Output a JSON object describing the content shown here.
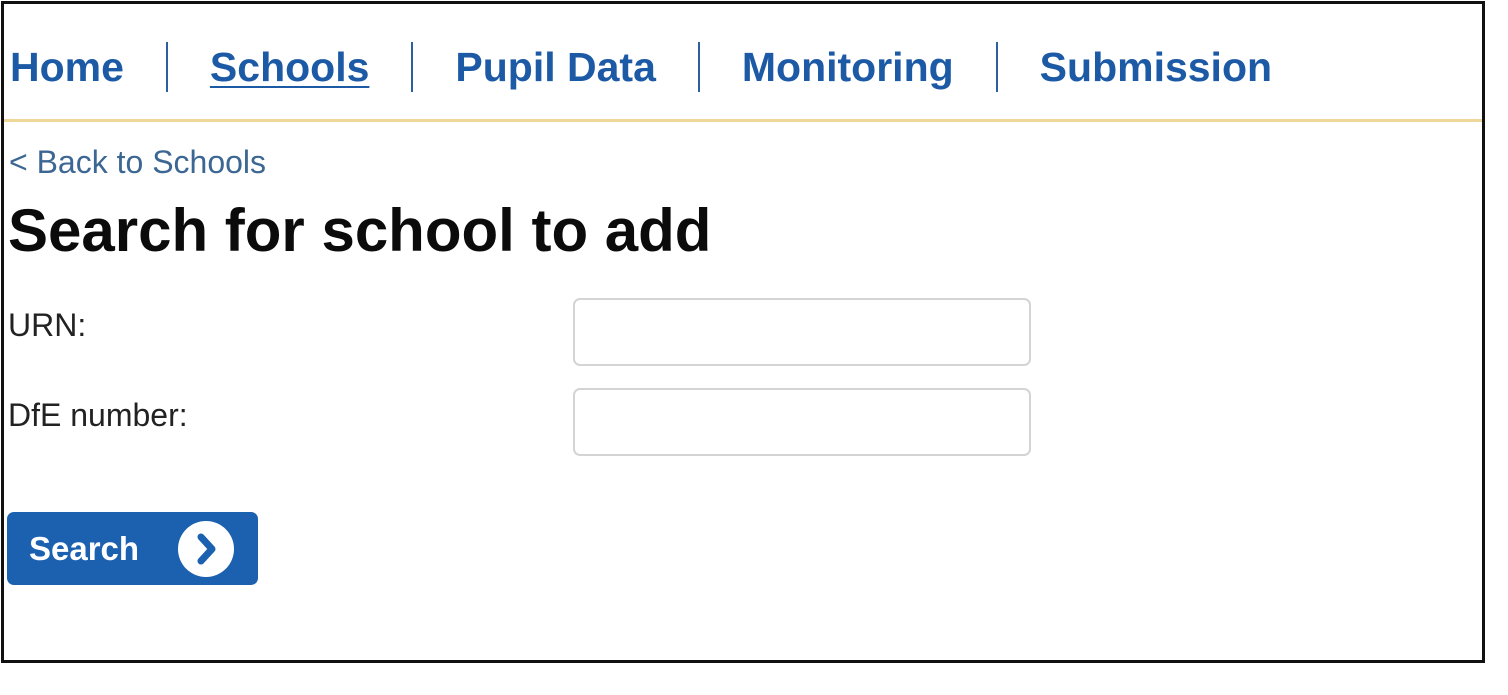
{
  "nav": {
    "items": [
      {
        "label": "Home",
        "active": false
      },
      {
        "label": "Schools",
        "active": true
      },
      {
        "label": "Pupil Data",
        "active": false
      },
      {
        "label": "Monitoring",
        "active": false
      },
      {
        "label": "Submission",
        "active": false
      }
    ]
  },
  "back_link": "< Back to Schools",
  "page_title": "Search for school to add",
  "form": {
    "urn": {
      "label": "URN:",
      "value": "",
      "placeholder": ""
    },
    "dfe_number": {
      "label": "DfE number:",
      "value": "",
      "placeholder": ""
    },
    "search_button": {
      "label": "Search",
      "icon": "chevron-right-icon"
    }
  },
  "colors": {
    "link": "#1d5aa6",
    "back_link": "#3d6793",
    "nav_rule": "#efd79a",
    "button": "#1c60b0"
  }
}
